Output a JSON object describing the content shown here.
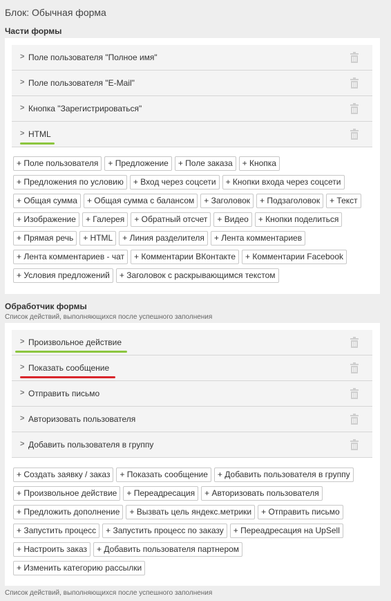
{
  "block_title": "Блок: Обычная форма",
  "form_parts": {
    "title": "Части формы",
    "rows": [
      {
        "label": "Поле пользователя \"Полное имя\""
      },
      {
        "label": "Поле пользователя \"E-Mail\""
      },
      {
        "label": "Кнопка \"Зарегистрироваться\""
      },
      {
        "label": "HTML"
      }
    ],
    "chips": [
      [
        "+ Поле пользователя",
        "+ Предложение",
        "+ Поле заказа",
        "+ Кнопка"
      ],
      [
        "+ Предложения по условию",
        "+ Вход через соцсети",
        "+ Кнопки входа через соцсети"
      ],
      [
        "+ Общая сумма",
        "+ Общая сумма с балансом",
        "+ Заголовок",
        "+ Подзаголовок",
        "+ Текст"
      ],
      [
        "+ Изображение",
        "+ Галерея",
        "+ Обратный отсчет",
        "+ Видео",
        "+ Кнопки поделиться"
      ],
      [
        "+ Прямая речь",
        "+ HTML",
        "+ Линия разделителя",
        "+ Лента комментариев"
      ],
      [
        "+ Лента комментариев - чат",
        "+ Комментарии ВКонтакте",
        "+ Комментарии Facebook"
      ],
      [
        "+ Условия предложений",
        "+ Заголовок с раскрывающимся текстом"
      ]
    ]
  },
  "form_handler": {
    "title": "Обработчик формы",
    "subtitle": "Список действий, выполняющихся после успешного заполнения",
    "rows": [
      {
        "label": "Произвольное действие"
      },
      {
        "label": "Показать сообщение"
      },
      {
        "label": "Отправить письмо"
      },
      {
        "label": "Авторизовать пользователя"
      },
      {
        "label": "Добавить пользователя в группу"
      }
    ],
    "chips": [
      [
        "+ Создать заявку / заказ",
        "+ Показать сообщение",
        "+ Добавить пользователя в группу"
      ],
      [
        "+ Произвольное действие",
        "+ Переадресация",
        "+ Авторизовать пользователя"
      ],
      [
        "+ Предложить дополнение",
        "+ Вызвать цель яндекс.метрики",
        "+ Отправить письмо"
      ],
      [
        "+ Запустить процесс",
        "+ Запустить процесс по заказу",
        "+ Переадресация на UpSell"
      ],
      [
        "+ Настроить заказ",
        "+ Добавить пользователя партнером"
      ],
      [
        "+ Изменить категорию рассылки"
      ]
    ]
  },
  "footer_subtitle": "Список действий, выполняющихся после успешного заполнения",
  "colors": {
    "green_highlight": "#8cc63f",
    "red_highlight": "#d9262c"
  },
  "icons": {
    "chevron": "chevron-right-icon",
    "trash": "trash-icon"
  }
}
